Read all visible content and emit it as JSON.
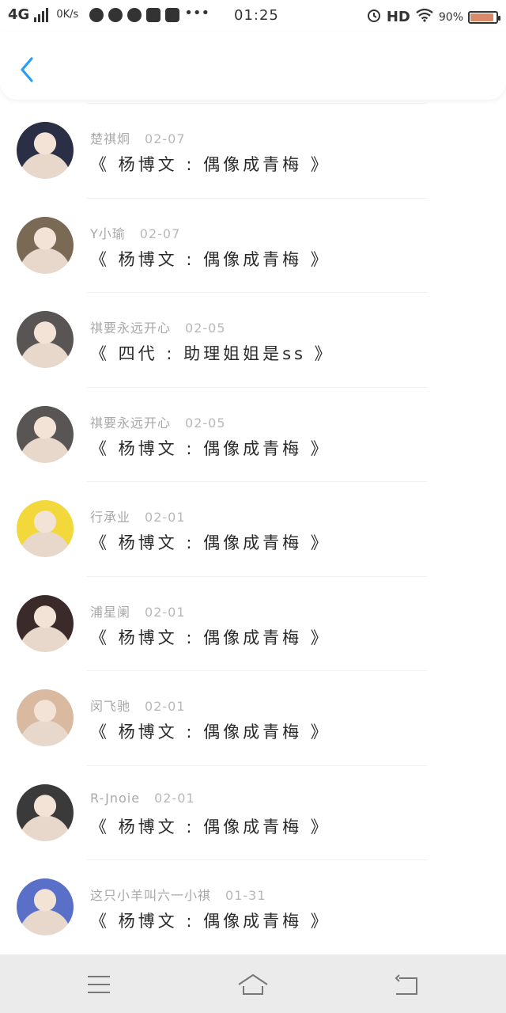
{
  "status_bar": {
    "network": "4G",
    "speed": "0K/s",
    "time": "01:25",
    "hd": "HD",
    "battery_text": "90%",
    "battery_level": 0.9
  },
  "messages": [
    {
      "name": "楚祺炯",
      "date": "02-07",
      "title": "《 杨博文 : 偶像成青梅 》",
      "avatar_color": "#2a2f45"
    },
    {
      "name": "Y小瑜",
      "date": "02-07",
      "title": "《 杨博文 : 偶像成青梅 》",
      "avatar_color": "#7a6a55"
    },
    {
      "name": "祺要永远开心",
      "date": "02-05",
      "title": "《 四代 : 助理姐姐是ss 》",
      "avatar_color": "#5a5555"
    },
    {
      "name": "祺要永远开心",
      "date": "02-05",
      "title": "《 杨博文 : 偶像成青梅 》",
      "avatar_color": "#5a5555"
    },
    {
      "name": "行承业",
      "date": "02-01",
      "title": "《 杨博文 : 偶像成青梅 》",
      "avatar_color": "#f2d83a"
    },
    {
      "name": "浦星阑",
      "date": "02-01",
      "title": "《 杨博文 : 偶像成青梅 》",
      "avatar_color": "#3a2a2a"
    },
    {
      "name": "闵飞驰",
      "date": "02-01",
      "title": "《 杨博文 : 偶像成青梅 》",
      "avatar_color": "#d9b9a0"
    },
    {
      "name": "R-Jnoie",
      "date": "02-01",
      "title": "《 杨博文 : 偶像成青梅 》",
      "avatar_color": "#3a3a3a"
    },
    {
      "name": "这只小羊叫六一小祺",
      "date": "01-31",
      "title": "《 杨博文 : 偶像成青梅 》",
      "avatar_color": "#5a6fc8"
    }
  ],
  "colors": {
    "accent": "#2a9df4",
    "navbar_bg": "#ebebeb"
  },
  "icons": {
    "back": "chevron-left-icon",
    "menu": "menu-icon",
    "home": "home-icon",
    "return": "return-icon"
  }
}
